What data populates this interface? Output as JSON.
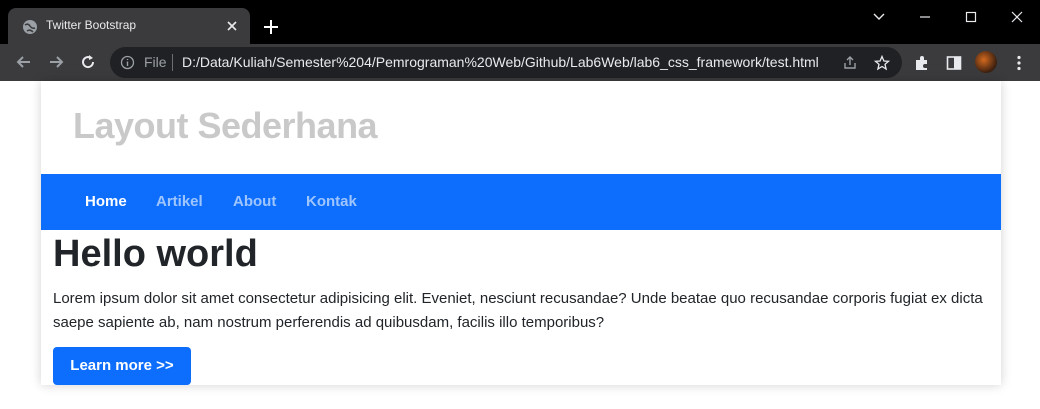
{
  "browser": {
    "tab": {
      "title": "Twitter Bootstrap",
      "favicon": "globe-icon"
    },
    "address_bar": {
      "scheme_label": "File",
      "url": "D:/Data/Kuliah/Semester%204/Pemrograman%20Web/Github/Lab6Web/lab6_css_framework/test.html"
    }
  },
  "page": {
    "site_title": "Layout Sederhana",
    "nav": [
      {
        "label": "Home",
        "active": true
      },
      {
        "label": "Artikel",
        "active": false
      },
      {
        "label": "About",
        "active": false
      },
      {
        "label": "Kontak",
        "active": false
      }
    ],
    "hero": {
      "title": "Hello world",
      "text": "Lorem ipsum dolor sit amet consectetur adipisicing elit. Eveniet, nesciunt recusandae? Unde beatae quo recusandae corporis fugiat ex dicta saepe sapiente ab, nam nostrum perferendis ad quibusdam, facilis illo temporibus?",
      "button_label": "Learn more >>"
    }
  },
  "colors": {
    "navbar": "#0d6efd",
    "button": "#0d6efd",
    "title_muted": "#c9c9c9",
    "browser_frame": "#000000",
    "toolbar": "#3b3b3d"
  }
}
